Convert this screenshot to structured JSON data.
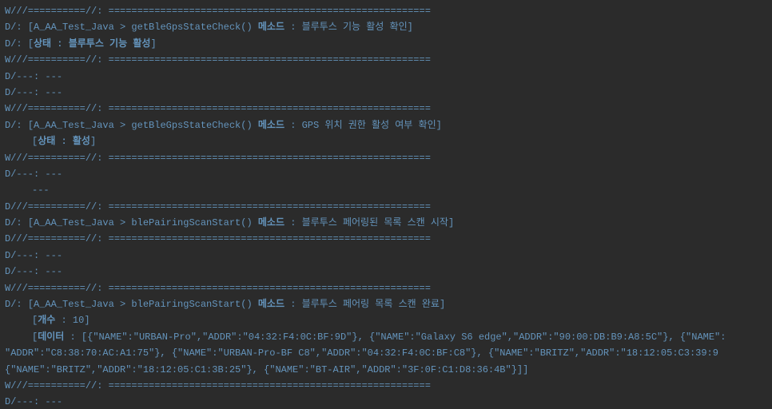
{
  "lines": [
    {
      "cls": "",
      "spans": [
        {
          "c": "prefix-w",
          "t": "W///==========//: "
        },
        {
          "c": "sep",
          "t": "========================================================"
        }
      ]
    },
    {
      "cls": "",
      "spans": [
        {
          "c": "prefix-d",
          "t": "D/: "
        },
        {
          "c": "tag",
          "t": "["
        },
        {
          "c": "content",
          "t": "A_AA_Test_Java > getBleGpsStateCheck() "
        },
        {
          "c": "strong",
          "t": "메소드"
        },
        {
          "c": "content",
          "t": " : 블루투스 기능 활성 확인"
        },
        {
          "c": "tag",
          "t": "]"
        }
      ]
    },
    {
      "cls": "",
      "spans": [
        {
          "c": "prefix-d",
          "t": "D/: "
        },
        {
          "c": "tag",
          "t": "["
        },
        {
          "c": "strong",
          "t": "상태 : 블루투스 기능 활성"
        },
        {
          "c": "tag",
          "t": "]"
        }
      ]
    },
    {
      "cls": "",
      "spans": [
        {
          "c": "prefix-w",
          "t": "W///==========//: "
        },
        {
          "c": "sep",
          "t": "========================================================"
        }
      ]
    },
    {
      "cls": "",
      "spans": [
        {
          "c": "prefix-d",
          "t": "D/---: "
        },
        {
          "c": "dash",
          "t": "---"
        }
      ]
    },
    {
      "cls": "",
      "spans": [
        {
          "c": "prefix-d",
          "t": "D/---: "
        },
        {
          "c": "dash",
          "t": "---"
        }
      ]
    },
    {
      "cls": "",
      "spans": [
        {
          "c": "prefix-w",
          "t": "W///==========//: "
        },
        {
          "c": "sep",
          "t": "========================================================"
        }
      ]
    },
    {
      "cls": "",
      "spans": [
        {
          "c": "prefix-d",
          "t": "D/: "
        },
        {
          "c": "tag",
          "t": "["
        },
        {
          "c": "content",
          "t": "A_AA_Test_Java > getBleGpsStateCheck() "
        },
        {
          "c": "strong",
          "t": "메소드"
        },
        {
          "c": "content",
          "t": " : GPS 위치 권한 활성 여부 확인"
        },
        {
          "c": "tag",
          "t": "]"
        }
      ]
    },
    {
      "cls": "indent",
      "spans": [
        {
          "c": "tag",
          "t": "["
        },
        {
          "c": "strong",
          "t": "상태 : 활성"
        },
        {
          "c": "tag",
          "t": "]"
        }
      ]
    },
    {
      "cls": "",
      "spans": [
        {
          "c": "prefix-w",
          "t": "W///==========//: "
        },
        {
          "c": "sep",
          "t": "========================================================"
        }
      ]
    },
    {
      "cls": "",
      "spans": [
        {
          "c": "prefix-d",
          "t": "D/---: "
        },
        {
          "c": "dash",
          "t": "---"
        }
      ]
    },
    {
      "cls": "indent",
      "spans": [
        {
          "c": "dash",
          "t": "---"
        }
      ]
    },
    {
      "cls": "",
      "spans": [
        {
          "c": "prefix-d",
          "t": "D///==========//: "
        },
        {
          "c": "sep",
          "t": "========================================================"
        }
      ]
    },
    {
      "cls": "",
      "spans": [
        {
          "c": "prefix-d",
          "t": "D/: "
        },
        {
          "c": "tag",
          "t": "["
        },
        {
          "c": "content",
          "t": "A_AA_Test_Java > blePairingScanStart() "
        },
        {
          "c": "strong",
          "t": "메소드"
        },
        {
          "c": "content",
          "t": " : 블루투스 페어링된 목록 스캔 시작"
        },
        {
          "c": "tag",
          "t": "]"
        }
      ]
    },
    {
      "cls": "",
      "spans": [
        {
          "c": "prefix-d",
          "t": "D///==========//: "
        },
        {
          "c": "sep",
          "t": "========================================================"
        }
      ]
    },
    {
      "cls": "",
      "spans": [
        {
          "c": "prefix-d",
          "t": "D/---: "
        },
        {
          "c": "dash",
          "t": "---"
        }
      ]
    },
    {
      "cls": "",
      "spans": [
        {
          "c": "prefix-d",
          "t": "D/---: "
        },
        {
          "c": "dash",
          "t": "---"
        }
      ]
    },
    {
      "cls": "",
      "spans": [
        {
          "c": "prefix-w",
          "t": "W///==========//: "
        },
        {
          "c": "sep",
          "t": "========================================================"
        }
      ]
    },
    {
      "cls": "",
      "spans": [
        {
          "c": "prefix-d",
          "t": "D/: "
        },
        {
          "c": "tag",
          "t": "["
        },
        {
          "c": "content",
          "t": "A_AA_Test_Java > blePairingScanStart() "
        },
        {
          "c": "strong",
          "t": "메소드"
        },
        {
          "c": "content",
          "t": " : 블루투스 페어링 목록 스캔 완료"
        },
        {
          "c": "tag",
          "t": "]"
        }
      ]
    },
    {
      "cls": "indent",
      "spans": [
        {
          "c": "tag",
          "t": "["
        },
        {
          "c": "strong",
          "t": "개수"
        },
        {
          "c": "content",
          "t": " : 10"
        },
        {
          "c": "tag",
          "t": "]"
        }
      ]
    },
    {
      "cls": "indent",
      "spans": [
        {
          "c": "tag",
          "t": "["
        },
        {
          "c": "strong",
          "t": "데이터"
        },
        {
          "c": "content",
          "t": " : [{\"NAME\":\"URBAN-Pro\",\"ADDR\":\"04:32:F4:0C:BF:9D\"}, {\"NAME\":\"Galaxy S6 edge\",\"ADDR\":\"90:00:DB:B9:A8:5C\"}, {\"NAME\":"
        }
      ]
    },
    {
      "cls": "",
      "spans": [
        {
          "c": "content",
          "t": "  \"ADDR\":\"C8:38:70:AC:A1:75\"}, {\"NAME\":\"URBAN-Pro-BF C8\",\"ADDR\":\"04:32:F4:0C:BF:C8\"}, {\"NAME\":\"BRITZ\",\"ADDR\":\"18:12:05:C3:39:9"
        }
      ]
    },
    {
      "cls": "",
      "spans": [
        {
          "c": "content",
          "t": "  {\"NAME\":\"BRITZ\",\"ADDR\":\"18:12:05:C1:3B:25\"}, {\"NAME\":\"BT-AIR\",\"ADDR\":\"3F:0F:C1:D8:36:4B\"}]"
        },
        {
          "c": "tag",
          "t": "]"
        }
      ]
    },
    {
      "cls": "",
      "spans": [
        {
          "c": "prefix-w",
          "t": "W///==========//: "
        },
        {
          "c": "sep",
          "t": "========================================================"
        }
      ]
    },
    {
      "cls": "",
      "spans": [
        {
          "c": "prefix-d",
          "t": "D/---: "
        },
        {
          "c": "dash",
          "t": "---"
        }
      ]
    }
  ]
}
